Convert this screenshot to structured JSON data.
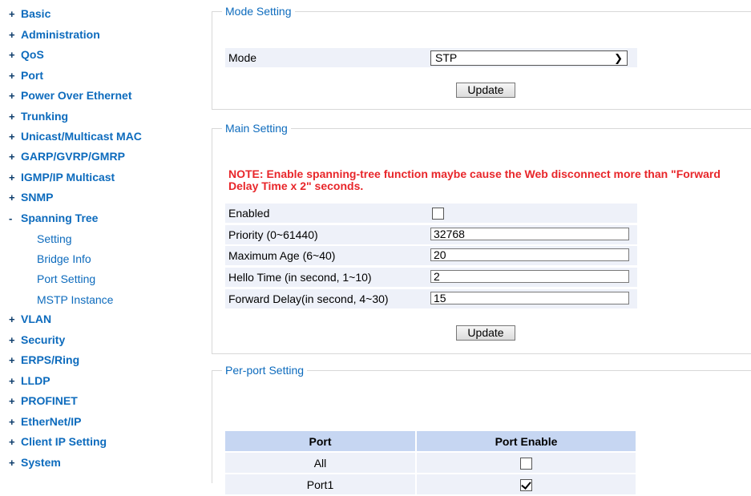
{
  "sidebar": {
    "items": [
      {
        "sign": "+",
        "label": "Basic"
      },
      {
        "sign": "+",
        "label": "Administration"
      },
      {
        "sign": "+",
        "label": "QoS"
      },
      {
        "sign": "+",
        "label": "Port"
      },
      {
        "sign": "+",
        "label": "Power Over Ethernet"
      },
      {
        "sign": "+",
        "label": "Trunking"
      },
      {
        "sign": "+",
        "label": "Unicast/Multicast MAC"
      },
      {
        "sign": "+",
        "label": "GARP/GVRP/GMRP"
      },
      {
        "sign": "+",
        "label": "IGMP/IP Multicast"
      },
      {
        "sign": "+",
        "label": "SNMP"
      },
      {
        "sign": "-",
        "label": "Spanning Tree"
      },
      {
        "sign": "+",
        "label": "VLAN"
      },
      {
        "sign": "+",
        "label": "Security"
      },
      {
        "sign": "+",
        "label": "ERPS/Ring"
      },
      {
        "sign": "+",
        "label": "LLDP"
      },
      {
        "sign": "+",
        "label": "PROFINET"
      },
      {
        "sign": "+",
        "label": "EtherNet/IP"
      },
      {
        "sign": "+",
        "label": "Client IP Setting"
      },
      {
        "sign": "+",
        "label": "System"
      }
    ],
    "spanning_tree_sub": [
      "Setting",
      "Bridge Info",
      "Port Setting",
      "MSTP Instance"
    ]
  },
  "mode_setting": {
    "legend": "Mode Setting",
    "mode_label": "Mode",
    "mode_value": "STP",
    "update_label": "Update"
  },
  "main_setting": {
    "legend": "Main Setting",
    "note": "NOTE: Enable spanning-tree function maybe cause the Web disconnect more than \"Forward Delay Time x 2\" seconds.",
    "enabled_label": "Enabled",
    "enabled_checked": false,
    "priority_label": "Priority (0~61440)",
    "priority_value": "32768",
    "max_age_label": "Maximum Age (6~40)",
    "max_age_value": "20",
    "hello_time_label": "Hello Time (in second, 1~10)",
    "hello_time_value": "2",
    "forward_delay_label": "Forward Delay(in second, 4~30)",
    "forward_delay_value": "15",
    "update_label": "Update"
  },
  "per_port_setting": {
    "legend": "Per-port Setting",
    "columns": [
      "Port",
      "Port Enable"
    ],
    "rows": [
      {
        "port": "All",
        "enabled": false
      },
      {
        "port": "Port1",
        "enabled": true
      }
    ]
  },
  "colors": {
    "nav_link": "#0d6bbd",
    "note": "#e8262a",
    "row_bg": "#eef1f9",
    "header_bg": "#c6d6f2"
  }
}
